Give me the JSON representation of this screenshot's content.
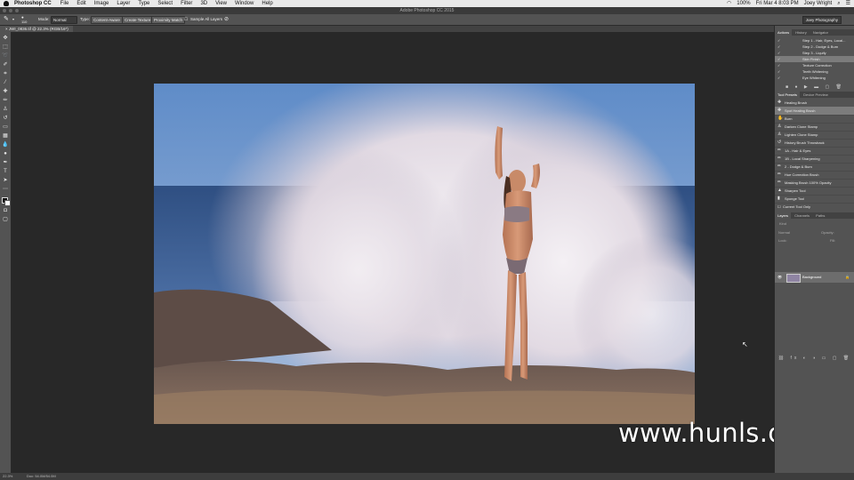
{
  "menubar": {
    "app": "Photoshop CC",
    "items": [
      "File",
      "Edit",
      "Image",
      "Layer",
      "Type",
      "Select",
      "Filter",
      "3D",
      "View",
      "Window",
      "Help"
    ],
    "battery": "100%",
    "datetime": "Fri Mar 4  8:03 PM",
    "user": "Joey Wright"
  },
  "window": {
    "title": "Adobe Photoshop CC 2015"
  },
  "options": {
    "brush_size": "110",
    "mode_label": "Mode:",
    "mode_value": "Normal",
    "type_label": "Type:",
    "type_options": [
      "Content-Aware",
      "Create Texture",
      "Proximity Match"
    ],
    "sample_all_layers": "Sample All Layers",
    "workspace": "Joey Photography"
  },
  "document": {
    "tab": "JWI_0836.tif @ 22.3% (RGB/16*)"
  },
  "actions_panel": {
    "tabs": [
      "Actions",
      "History",
      "Navigator"
    ],
    "rows": [
      {
        "label": "Step 1 - Hair, Eyes, Local...",
        "selected": false
      },
      {
        "label": "Step 2 - Dodge & Burn",
        "selected": false
      },
      {
        "label": "Step 3 - Liquify",
        "selected": false
      },
      {
        "label": "Skin Finish",
        "selected": true
      },
      {
        "label": "Texture Correction",
        "selected": false
      },
      {
        "label": "Teeth Whitening",
        "selected": false
      },
      {
        "label": "Eye Whitening",
        "selected": false
      }
    ]
  },
  "presets_panel": {
    "tabs": [
      "Tool Presets",
      "Device Preview"
    ],
    "rows": [
      {
        "label": "Healing Brush",
        "selected": false
      },
      {
        "label": "Spot Healing Brush",
        "selected": true
      },
      {
        "label": "Burn",
        "selected": false
      },
      {
        "label": "Darken Clone Stamp",
        "selected": false
      },
      {
        "label": "Lighten Clone Stamp",
        "selected": false
      },
      {
        "label": "History Brush Throwback",
        "selected": false
      },
      {
        "label": "1A - Hair & Eyes",
        "selected": false
      },
      {
        "label": "1B - Local Sharpening",
        "selected": false
      },
      {
        "label": "2 - Dodge & Burn",
        "selected": false
      },
      {
        "label": "Hue Correction Brush",
        "selected": false
      },
      {
        "label": "Masking Brush 100% Opacity",
        "selected": false
      },
      {
        "label": "Sharpen Tool",
        "selected": false
      },
      {
        "label": "Sponge Tool",
        "selected": false
      }
    ],
    "current_tool_only": "Current Tool Only"
  },
  "layers_panel": {
    "tabs": [
      "Layers",
      "Channels",
      "Paths"
    ],
    "kind_label": "Kind",
    "blend": "Normal",
    "opacity_label": "Opacity:",
    "lock_label": "Lock:",
    "fill_label": "Fill:",
    "layer_name": "Background"
  },
  "statusbar": {
    "zoom": "22.3%",
    "info": "Doc: 54.0M/54.0M"
  },
  "watermark": "www.hunls.com"
}
